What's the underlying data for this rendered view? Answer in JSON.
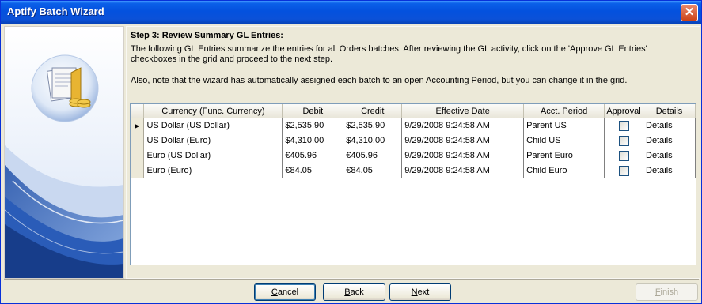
{
  "window": {
    "title": "Aptify Batch Wizard",
    "close_glyph": "✕"
  },
  "step": {
    "title": "Step 3:  Review Summary GL Entries:",
    "description_1": "The following GL Entries summarize the entries for all Orders batches. After reviewing the GL activity, click on the 'Approve GL Entries' checkboxes in the grid and proceed to the next step.",
    "description_2": "Also, note that the wizard has automatically assigned each batch to an open Accounting Period, but you can change it in the grid."
  },
  "grid": {
    "row_indicator": "▶",
    "columns": [
      "Currency (Func. Currency)",
      "Debit",
      "Credit",
      "Effective Date",
      "Acct. Period",
      "Approval",
      "Details"
    ],
    "rows": [
      {
        "currency": "US Dollar (US Dollar)",
        "debit": "$2,535.90",
        "credit": "$2,535.90",
        "date": "9/29/2008  9:24:58 AM",
        "period": "Parent US",
        "approval": false,
        "details": "Details"
      },
      {
        "currency": "US Dollar (Euro)",
        "debit": "$4,310.00",
        "credit": "$4,310.00",
        "date": "9/29/2008  9:24:58 AM",
        "period": "Child US",
        "approval": false,
        "details": "Details"
      },
      {
        "currency": "Euro (US Dollar)",
        "debit": "€405.96",
        "credit": "€405.96",
        "date": "9/29/2008  9:24:58 AM",
        "period": "Parent Euro",
        "approval": false,
        "details": "Details"
      },
      {
        "currency": "Euro (Euro)",
        "debit": "€84.05",
        "credit": "€84.05",
        "date": "9/29/2008  9:24:58 AM",
        "period": "Child Euro",
        "approval": false,
        "details": "Details"
      }
    ]
  },
  "buttons": {
    "cancel": {
      "mnemonic": "C",
      "rest": "ancel"
    },
    "back": {
      "mnemonic": "B",
      "rest": "ack"
    },
    "next": {
      "mnemonic": "N",
      "rest": "ext"
    },
    "finish": {
      "mnemonic": "F",
      "rest": "inish"
    }
  },
  "colors": {
    "titlebar": "#0451de",
    "window_bg": "#ece9d8",
    "close_button": "#cc4418",
    "grid_border": "#7f9db9"
  },
  "icons": {
    "wizard_graphic": "documents-folder-coins-icon"
  }
}
